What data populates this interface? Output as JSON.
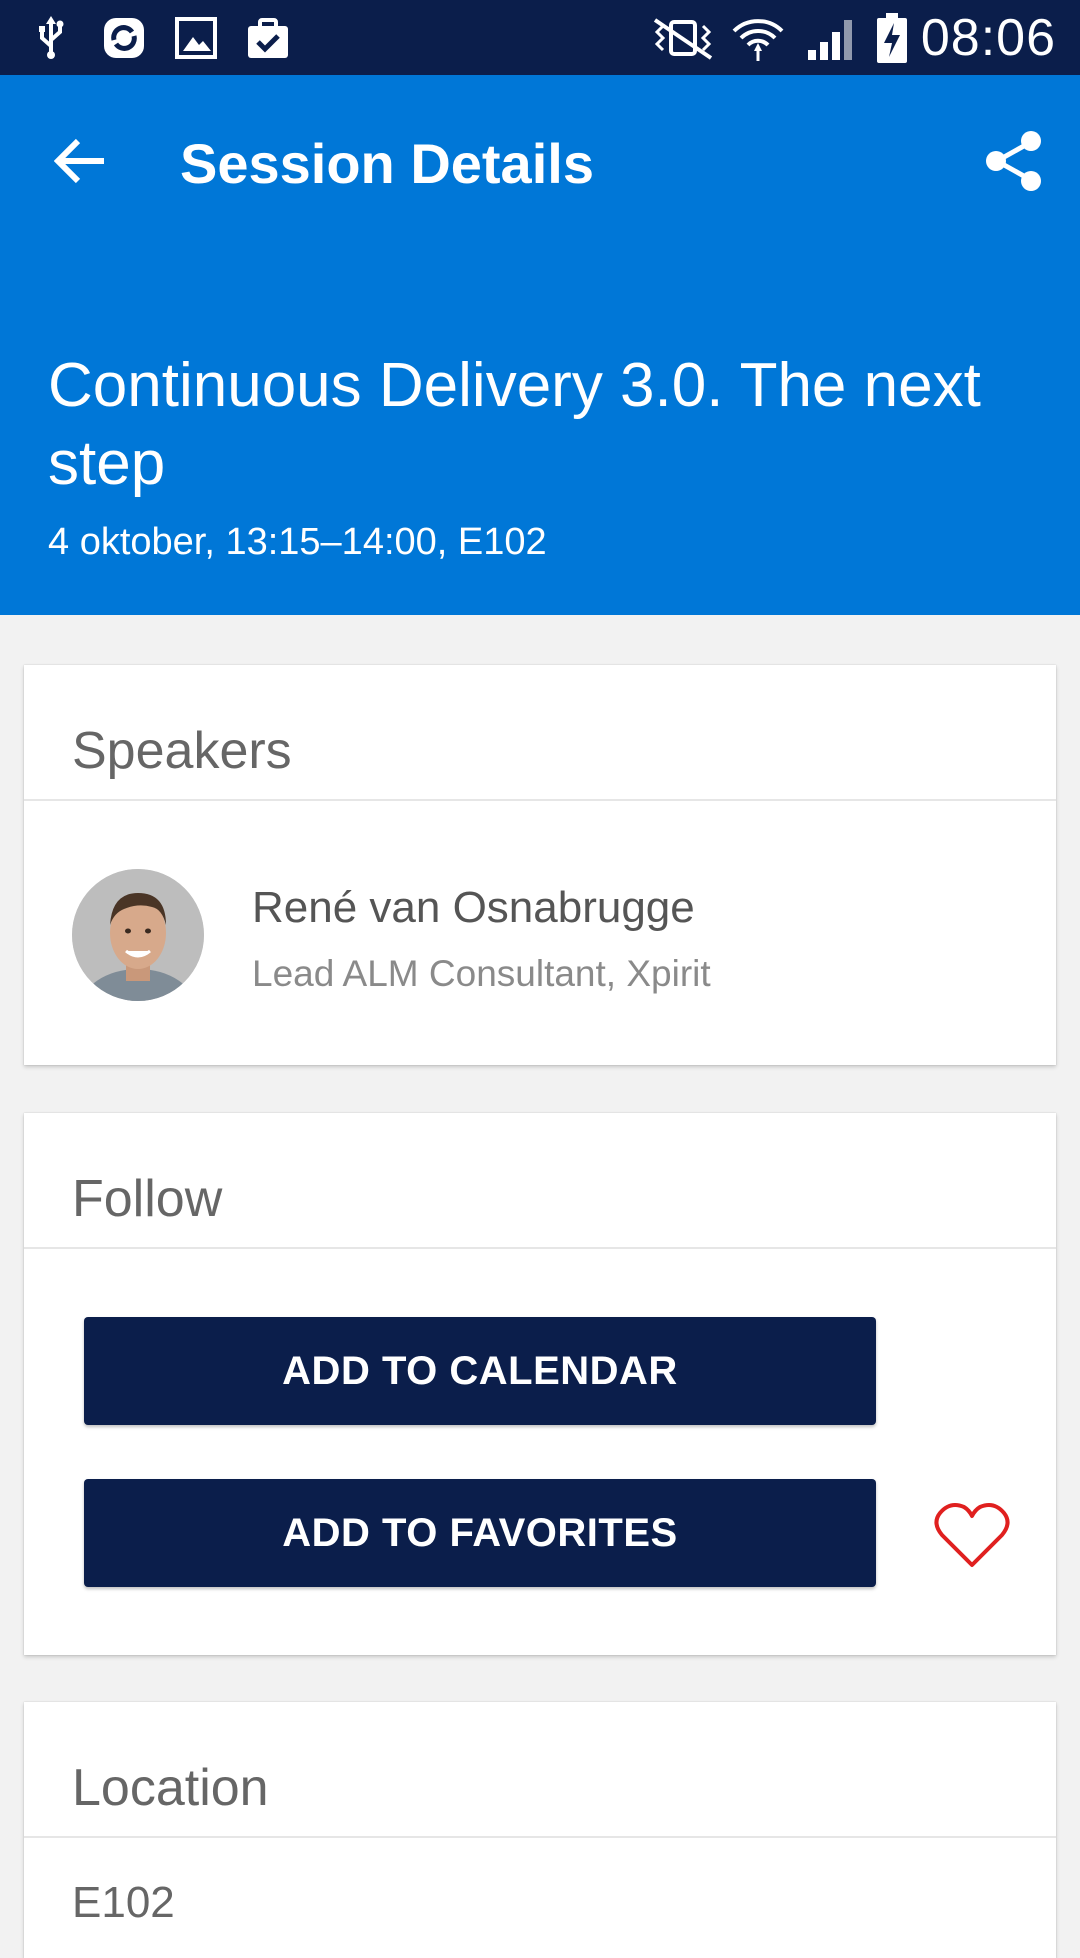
{
  "status_bar": {
    "time": "08:06",
    "left_icons": [
      "usb-icon",
      "sync-icon",
      "image-icon",
      "clipboard-check-icon"
    ],
    "right_icons": [
      "vibrate-mute-icon",
      "wifi-icon",
      "signal-icon",
      "battery-charging-icon"
    ]
  },
  "app_bar": {
    "title": "Session Details",
    "back_icon": "arrow-left-icon",
    "share_icon": "share-icon"
  },
  "session": {
    "title": "Continuous Delivery 3.0. The next step",
    "meta": "4 oktober, 13:15–14:00, E102"
  },
  "speakers": {
    "header": "Speakers",
    "items": [
      {
        "name": "René van Osnabrugge",
        "title": "Lead ALM Consultant, Xpirit"
      }
    ]
  },
  "follow": {
    "header": "Follow",
    "add_to_calendar": "ADD TO CALENDAR",
    "add_to_favorites": "ADD TO FAVORITES",
    "favorite_icon": "heart-outline-icon"
  },
  "location": {
    "header": "Location",
    "value": "E102"
  },
  "colors": {
    "status_bar": "#0b1e4b",
    "header": "#0077d7",
    "button": "#0b1e4b",
    "heart": "#e0201f",
    "background": "#f2f2f2"
  }
}
